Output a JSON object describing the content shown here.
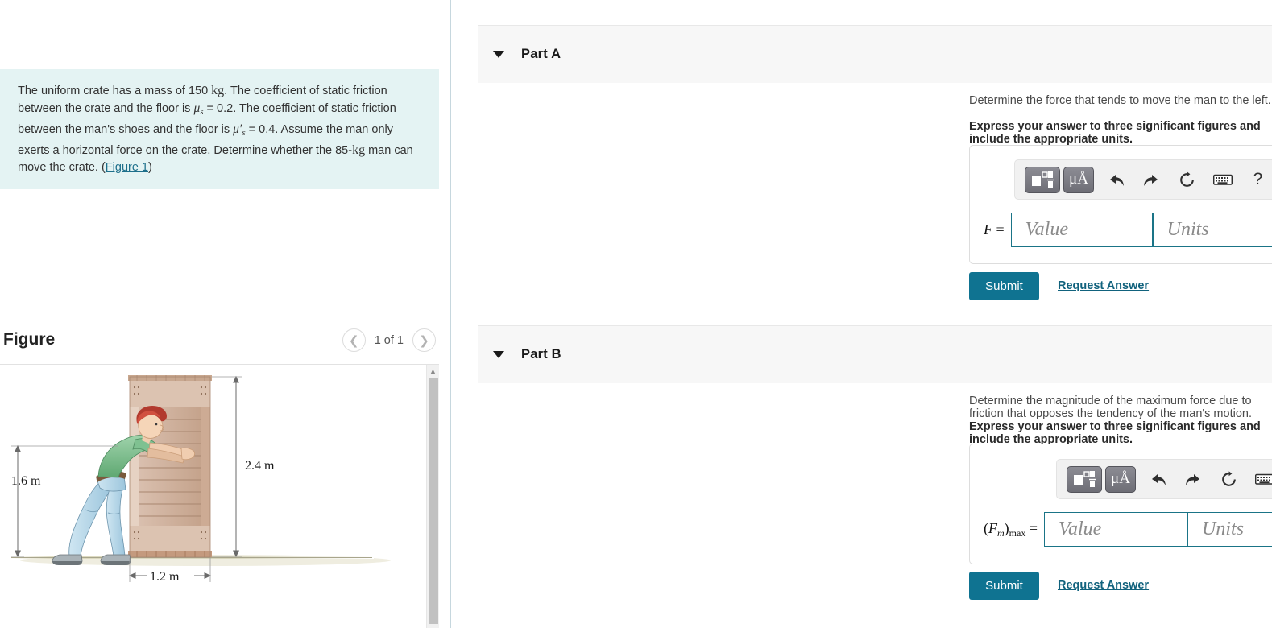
{
  "problem": {
    "text_part1": "The uniform crate has a mass of 150 ",
    "mass_unit": "kg",
    "text_part2": ". The coefficient of static friction between the crate and the floor is ",
    "mu_s": "μ",
    "mu_s_sub": "s",
    "mu_s_value": " = 0.2. The coefficient of static friction between the man's shoes and the floor is ",
    "mu_s_prime": "μ′",
    "mu_s_prime_sub": "s",
    "mu_s_prime_value": " = 0.4. Assume the man only exerts a horizontal force on the crate. Determine whether the 85-",
    "man_mass_unit": "kg",
    "text_part3": " man can move the crate. (",
    "figure_link": "Figure 1",
    "text_part4": ")",
    "background_color": "#e4f3f3"
  },
  "figure": {
    "title": "Figure",
    "pager_label": "1 of 1",
    "prev_icon": "chevron-left-icon",
    "next_icon": "chevron-right-icon",
    "scroll_up_icon": "triangle-up-icon",
    "diagram": {
      "height_label": "1.6 m",
      "crate_height_label": "2.4 m",
      "crate_width_label": "1.2 m",
      "man_hair_color": "#c0392b",
      "man_shirt_color": "#7fbf8f",
      "man_jeans_color": "#b5d8ea",
      "man_shoe_color": "#9aa3a8",
      "crate_color": "#d6bcab",
      "crate_slat_color": "#c9a892",
      "ground_color": "#d8d6bd"
    }
  },
  "parts": [
    {
      "id": "a",
      "caret_icon": "caret-down-icon",
      "label": "Part A",
      "prompt": "Determine the force that tends to move the man to the left.",
      "instruction": "Express your answer to three significant figures and include the appropriate units.",
      "toolbar": {
        "template_icon": "math-template-icon",
        "units_icon": "mu-angstrom-icon",
        "units_label": "μÅ",
        "undo_icon": "undo-icon",
        "redo_icon": "redo-icon",
        "reset_icon": "reset-icon",
        "keyboard_icon": "keyboard-icon",
        "help_icon": "help-icon",
        "help_label": "?"
      },
      "answer_label_main": "F",
      "answer_label_sub": "",
      "answer_label_eq": " =",
      "value_placeholder": "Value",
      "units_placeholder": "Units",
      "submit_label": "Submit",
      "request_label": "Request Answer"
    },
    {
      "id": "b",
      "caret_icon": "caret-down-icon",
      "label": "Part B",
      "prompt": "Determine the magnitude of the maximum force due to friction that opposes the tendency of the man's motion.",
      "instruction": "Express your answer to three significant figures and include the appropriate units.",
      "toolbar": {
        "template_icon": "math-template-icon",
        "units_icon": "mu-angstrom-icon",
        "units_label": "μÅ",
        "undo_icon": "undo-icon",
        "redo_icon": "redo-icon",
        "reset_icon": "reset-icon",
        "keyboard_icon": "keyboard-icon",
        "help_icon": "help-icon",
        "help_label": "?"
      },
      "answer_label_main": "F",
      "answer_label_sub": "m",
      "answer_label_max": "max",
      "answer_label_eq": " =",
      "value_placeholder": "Value",
      "units_placeholder": "Units",
      "submit_label": "Submit",
      "request_label": "Request Answer"
    }
  ],
  "colors": {
    "accent_teal": "#0f7391",
    "link_teal": "#11627d",
    "input_border": "#1a7487",
    "header_bg": "#f7f7f7",
    "divider": "#c6d7de"
  }
}
